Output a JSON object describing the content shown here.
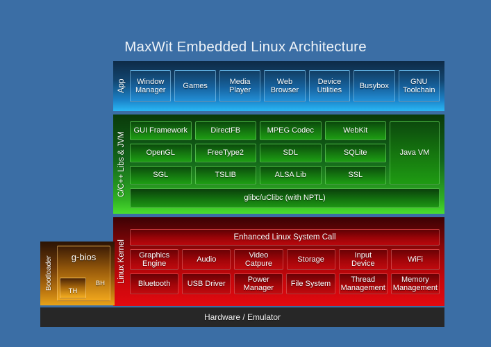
{
  "title": "MaxWit Embedded Linux Architecture",
  "colors": {
    "background": "#3b6ea5",
    "app_layer": "#1b82c8",
    "libs_layer": "#2fae22",
    "kernel_layer": "#c7060b",
    "bootloader": "#e8a319",
    "hardware": "#272727",
    "text": "#ffffff"
  },
  "layers": {
    "app": {
      "label": "App",
      "cells": [
        "Window\nManager",
        "Games",
        "Media\nPlayer",
        "Web\nBrowser",
        "Device\nUtilities",
        "Busybox",
        "GNU\nToolchain"
      ]
    },
    "libs": {
      "label": "C/C++ Libs & JVM",
      "rows": [
        [
          "GUI Framework",
          "DirectFB",
          "MPEG Codec",
          "WebKit"
        ],
        [
          "OpenGL",
          "FreeType2",
          "SDL",
          "SQLite"
        ],
        [
          "SGL",
          "TSLIB",
          "ALSA Lib",
          "SSL"
        ]
      ],
      "side_cell": "Java VM",
      "full_bar": "glibc/uClibc (with NPTL)"
    },
    "kernel": {
      "label": "Linux Kernel",
      "top_bar": "Enhanced Linux System Call",
      "rows": [
        [
          "Graphics\nEngine",
          "Audio",
          "Video\nCatpure",
          "Storage",
          "Input\nDevice",
          "WiFi"
        ],
        [
          "Bluetooth",
          "USB Driver",
          "Power\nManager",
          "File System",
          "Thread\nManagement",
          "Memory\nManagement"
        ]
      ]
    }
  },
  "bootloader": {
    "label": "Bootloader",
    "name": "g-bios",
    "bh_label": "BH",
    "th_label": "TH"
  },
  "hardware": {
    "label": "Hardware / Emulator"
  }
}
